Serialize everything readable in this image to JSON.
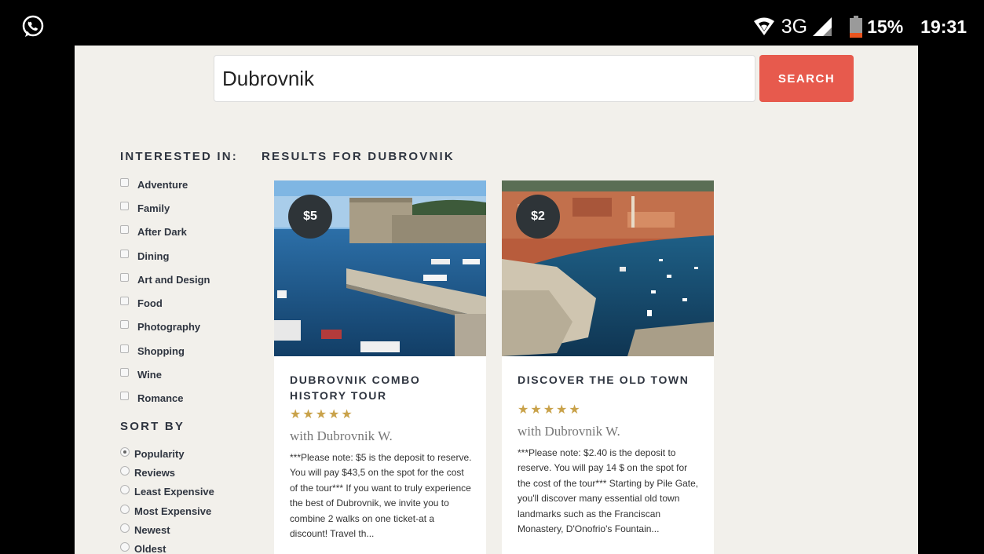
{
  "status_bar": {
    "network": "3G",
    "battery": "15%",
    "time": "19:31"
  },
  "search": {
    "value": "Dubrovnik",
    "button_label": "SEARCH"
  },
  "filters": {
    "heading": "INTERESTED IN:",
    "items": [
      "Adventure",
      "Family",
      "After Dark",
      "Dining",
      "Art and Design",
      "Food",
      "Photography",
      "Shopping",
      "Wine",
      "Romance"
    ]
  },
  "sort": {
    "heading": "SORT BY",
    "options": [
      "Popularity",
      "Reviews",
      "Least Expensive",
      "Most Expensive",
      "Newest",
      "Oldest"
    ],
    "selected": "Popularity"
  },
  "results": {
    "heading": "RESULTS FOR DUBROVNIK",
    "cards": [
      {
        "price": "$5",
        "title": "DUBROVNIK COMBO HISTORY TOUR",
        "rating_stars": "★★★★★",
        "guide": "with Dubrovnik W.",
        "description": "***Please note: $5 is the deposit to reserve. You will pay $43,5 on the spot for the cost of the tour*** If you want to truly experience the best of Dubrovnik, we invite you to combine 2 walks on one ticket-at a discount! Travel th..."
      },
      {
        "price": "$2",
        "title": "DISCOVER THE OLD TOWN",
        "rating_stars": "★★★★★",
        "guide": "with Dubrovnik W.",
        "description": "***Please note: $2.40 is the deposit to reserve. You will pay 14 $ on the spot for the cost of the tour*** Starting by Pile Gate, you'll discover many essential old town landmarks such as the Franciscan Monastery, D'Onofrio's Fountain..."
      }
    ]
  },
  "colors": {
    "accent": "#e75a4d",
    "page_bg": "#f2f0eb",
    "star": "#c9a24a",
    "badge": "#2e3438"
  }
}
